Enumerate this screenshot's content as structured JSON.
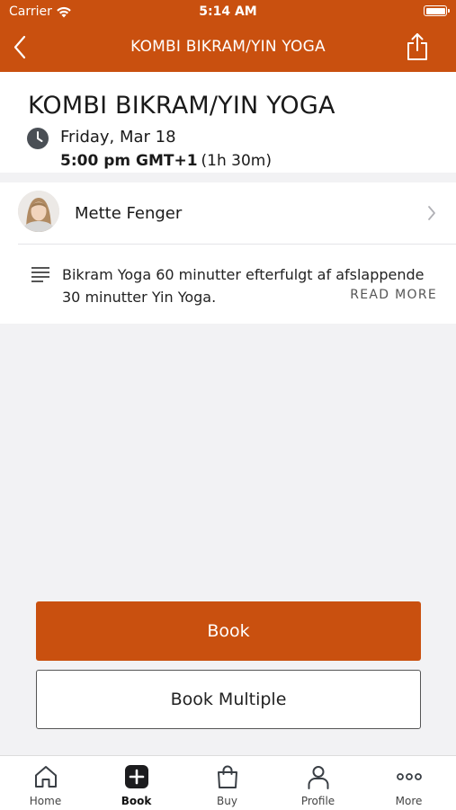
{
  "status_bar": {
    "carrier": "Carrier",
    "time": "5:14 AM"
  },
  "nav": {
    "title": "KOMBI BIKRAM/YIN YOGA"
  },
  "class": {
    "title": "KOMBI BIKRAM/YIN YOGA",
    "date": "Friday, Mar 18",
    "time": "5:00 pm GMT+1",
    "duration": "(1h 30m)"
  },
  "instructor": {
    "name": "Mette Fenger"
  },
  "description": {
    "text": "Bikram Yoga 60 minutter efterfulgt af afslappende 30 minutter Yin Yoga.",
    "read_more": "READ MORE"
  },
  "buttons": {
    "book": "Book",
    "book_multiple": "Book Multiple"
  },
  "tabs": [
    {
      "label": "Home",
      "icon": "home-icon"
    },
    {
      "label": "Book",
      "icon": "plus-square-icon",
      "active": true
    },
    {
      "label": "Buy",
      "icon": "shopping-bag-icon"
    },
    {
      "label": "Profile",
      "icon": "person-icon"
    },
    {
      "label": "More",
      "icon": "ellipsis-icon"
    }
  ],
  "colors": {
    "brand": "#c9500f",
    "background": "#f2f2f4"
  }
}
